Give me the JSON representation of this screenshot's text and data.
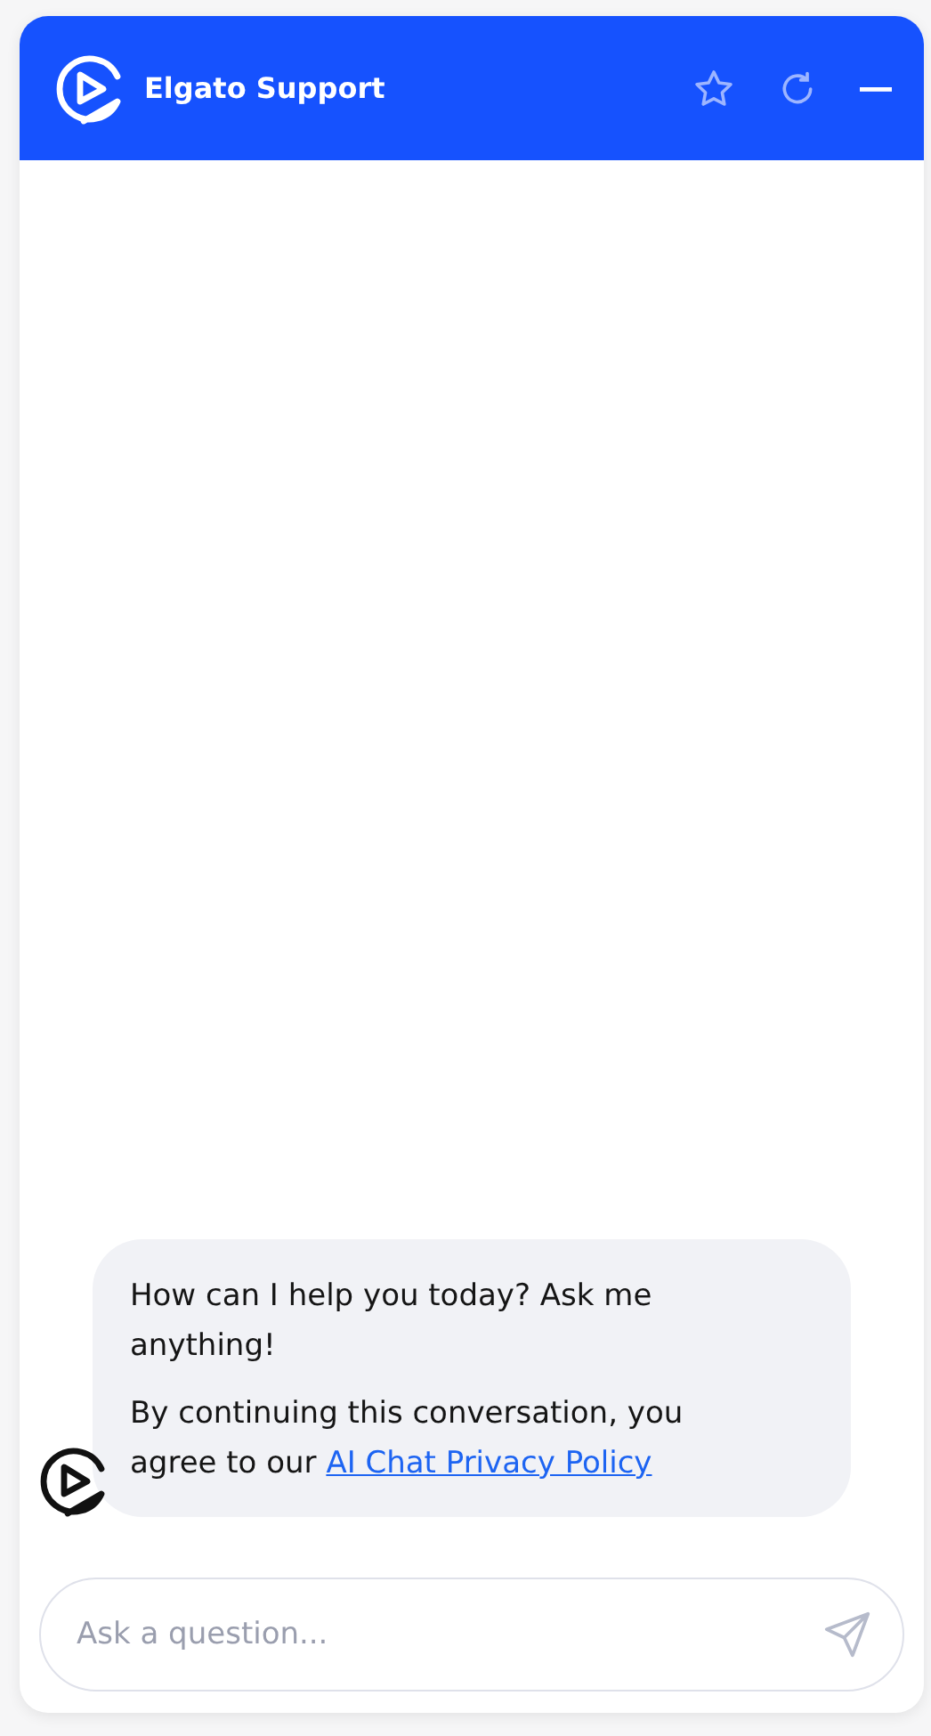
{
  "header": {
    "title": "Elgato Support"
  },
  "messages": [
    {
      "paragraphs": [
        {
          "text": "How can I help you today? Ask me anything!"
        },
        {
          "text": "By continuing this conversation, you agree to our ",
          "link": "AI Chat Privacy Policy"
        }
      ]
    }
  ],
  "composer": {
    "placeholder": "Ask a question..."
  }
}
